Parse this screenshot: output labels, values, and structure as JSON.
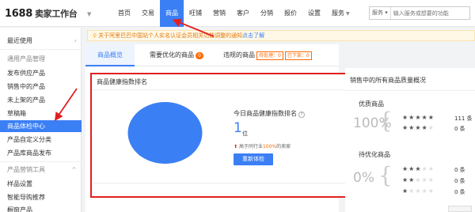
{
  "app": {
    "logo_number": "1688",
    "logo_text": "卖家工作台"
  },
  "nav": {
    "items": [
      {
        "label": "首页"
      },
      {
        "label": "交易"
      },
      {
        "label": "商品"
      },
      {
        "label": "旺铺"
      },
      {
        "label": "营销"
      },
      {
        "label": "客户"
      },
      {
        "label": "分销"
      },
      {
        "label": "报价"
      },
      {
        "label": "设置"
      },
      {
        "label": "服务"
      }
    ],
    "active_index": 2,
    "search": {
      "scope": "服务",
      "placeholder": "输入服务或想要的功能"
    }
  },
  "sidebar": {
    "recent": "最近使用",
    "group1": "通用产品管理",
    "items": [
      "发布供应产品",
      "销售中的产品",
      "未上架的产品",
      "草稿箱",
      "商品体检中心",
      "产品自定义分类",
      "产品库商品发布"
    ],
    "active_item": "商品体检中心",
    "group2": "产品营销工具",
    "items2": [
      "样品设置",
      "智能导购推荐",
      "橱窗产品"
    ]
  },
  "notice": {
    "text": "关于阿里巴巴中国站个人实名认证会员相关功能调整的通知",
    "link": "点击了解"
  },
  "tabs": {
    "overview": "商品概览",
    "optimize": "需要优化的商品",
    "optimize_count": "0",
    "violations": "违规的商品",
    "pending": "待处理：0",
    "removed": "已下架：0"
  },
  "health": {
    "title": "商品健康指数排名",
    "today_label": "今日商品健康指数排名",
    "help_icon": "?",
    "rank": "1",
    "rank_unit": "位",
    "peer_prefix": "高于同行业",
    "peer_pct": "100%",
    "peer_suffix": "的卖家",
    "button": "重新体检",
    "pie_color": "#3b7ff5"
  },
  "quality": {
    "title": "销售中的所有商品质量概况",
    "excellent_label": "优质商品",
    "excellent_pct": "100%",
    "excellent_rows": [
      {
        "stars": 5,
        "count": "111 条"
      },
      {
        "stars": 4,
        "count": "0 条"
      }
    ],
    "optimize_label": "待优化商品",
    "optimize_pct": "0%",
    "optimize_rows": [
      {
        "stars": 3,
        "count": "0 条"
      },
      {
        "stars": 2,
        "count": "0 条"
      },
      {
        "stars": 1,
        "count": "0 条"
      }
    ]
  }
}
